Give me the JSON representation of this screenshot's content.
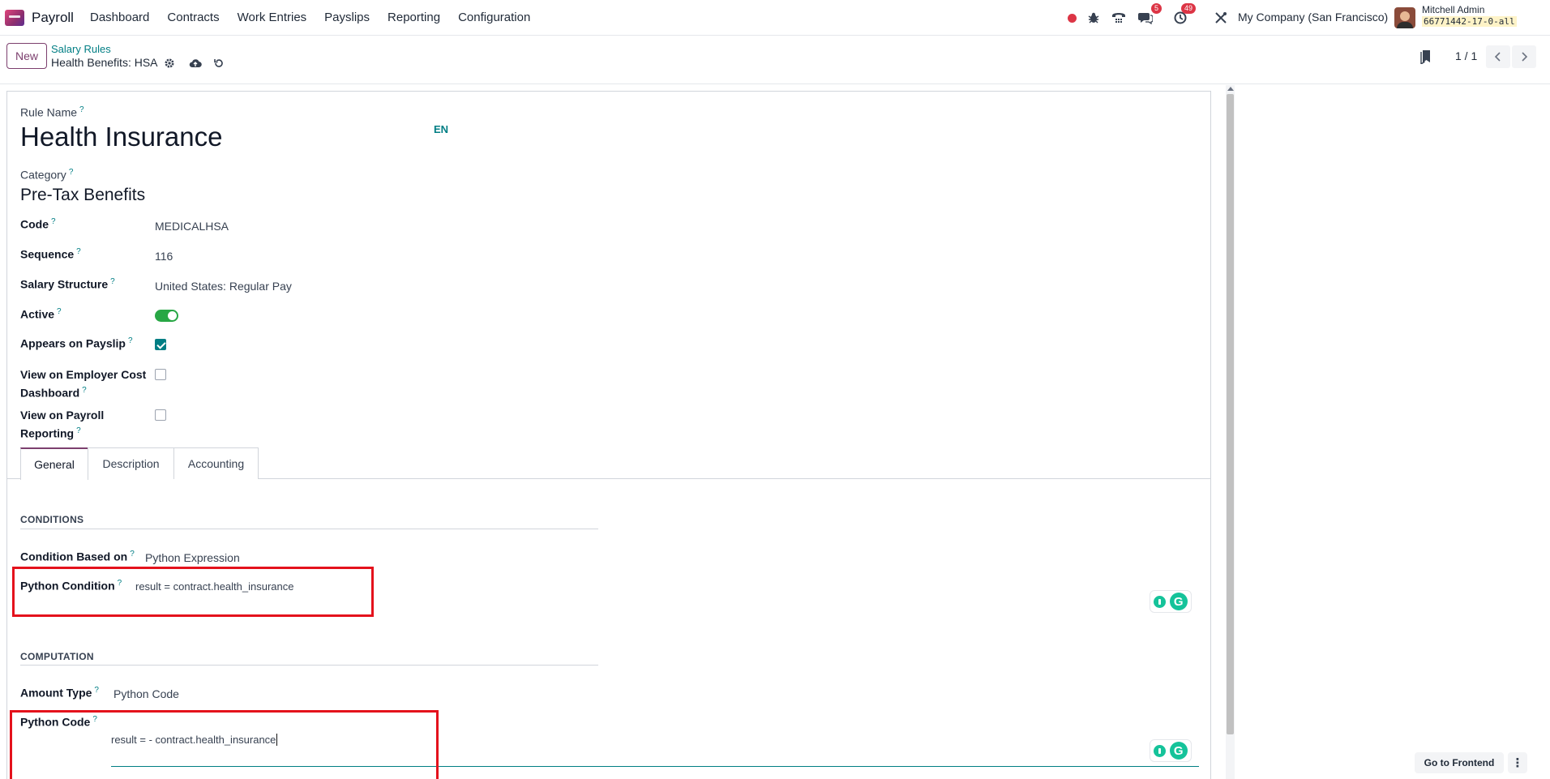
{
  "navbar": {
    "app_name": "Payroll",
    "menu": [
      "Dashboard",
      "Contracts",
      "Work Entries",
      "Payslips",
      "Reporting",
      "Configuration"
    ],
    "messages_count": "5",
    "activities_count": "49",
    "company": "My Company (San Francisco)",
    "user_name": "Mitchell Admin",
    "db_name": "66771442-17-0-all"
  },
  "control_panel": {
    "new_label": "New",
    "breadcrumb": "Salary Rules",
    "record_title": "Health Benefits: HSA",
    "pager": "1 / 1"
  },
  "form": {
    "rule_name_label": "Rule Name",
    "rule_name": "Health Insurance",
    "lang": "EN",
    "category_label": "Category",
    "category": "Pre-Tax Benefits",
    "code_label": "Code",
    "code": "MEDICALHSA",
    "sequence_label": "Sequence",
    "sequence": "116",
    "structure_label": "Salary Structure",
    "structure": "United States: Regular Pay",
    "active_label": "Active",
    "active": true,
    "payslip_label": "Appears on Payslip",
    "payslip": true,
    "employer_label_1": "View on Employer Cost",
    "employer_label_2": "Dashboard",
    "employer": false,
    "reporting_label_1": "View on Payroll",
    "reporting_label_2": "Reporting",
    "reporting": false
  },
  "tabs": [
    "General",
    "Description",
    "Accounting"
  ],
  "conditions": {
    "title": "CONDITIONS",
    "based_on_label": "Condition Based on",
    "based_on": "Python Expression",
    "python_condition_label": "Python Condition",
    "python_condition": "result = contract.health_insurance"
  },
  "computation": {
    "title": "COMPUTATION",
    "amount_type_label": "Amount Type",
    "amount_type": "Python Code",
    "python_code_label": "Python Code",
    "python_code": "result = - contract.health_insurance"
  },
  "footer": {
    "frontend_label": "Go to Frontend"
  },
  "colors": {
    "accent": "#017e84",
    "brand": "#7c3f6e",
    "highlight": "#e4121c"
  }
}
